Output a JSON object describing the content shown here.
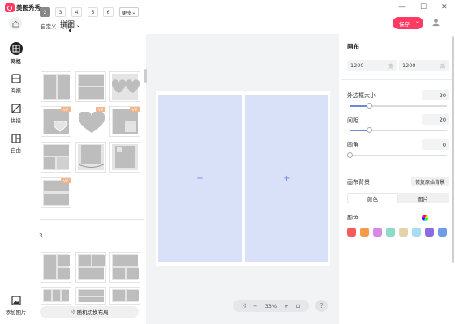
{
  "app": {
    "name": "美图秀秀",
    "mode_title": "拼图",
    "save_label": "保存"
  },
  "rail": {
    "items": [
      {
        "label": "网格",
        "icon": "grid-icon",
        "active": true
      },
      {
        "label": "海报",
        "icon": "poster-icon"
      },
      {
        "label": "拼接",
        "icon": "stitch-icon"
      },
      {
        "label": "自由",
        "icon": "freeform-icon"
      }
    ],
    "add_image_label": "添加图片"
  },
  "templates": {
    "count_tabs": [
      "2",
      "3",
      "4",
      "5",
      "6"
    ],
    "active_count": "2",
    "more_label": "更多",
    "subtabs": [
      "自定义",
      "异形"
    ],
    "vip_badge": "VIP",
    "section_label": "3",
    "shuffle_label": "随机切换布局"
  },
  "canvas": {
    "zoom": "33%",
    "slot_plus": "+",
    "help": "?"
  },
  "props": {
    "title": "画布",
    "width": "1200",
    "height": "1200",
    "width_unit": "宽",
    "height_unit": "高",
    "outer_border": {
      "label": "外边框大小",
      "value": "20",
      "fraction": 0.2
    },
    "spacing": {
      "label": "间距",
      "value": "20",
      "fraction": 0.2
    },
    "corner": {
      "label": "圆角",
      "value": "0",
      "fraction": 0.0
    },
    "background_label": "画布背景",
    "restore_label": "恢复原始背景",
    "seg_color": "颜色",
    "seg_image": "图片",
    "color_label": "颜色",
    "swatches": [
      "#f25c5c",
      "#f5994a",
      "#d889e3",
      "#8fd9c8",
      "#e3d3a8",
      "#a8dcf0",
      "#8a6be0",
      "#6f9be8"
    ]
  }
}
